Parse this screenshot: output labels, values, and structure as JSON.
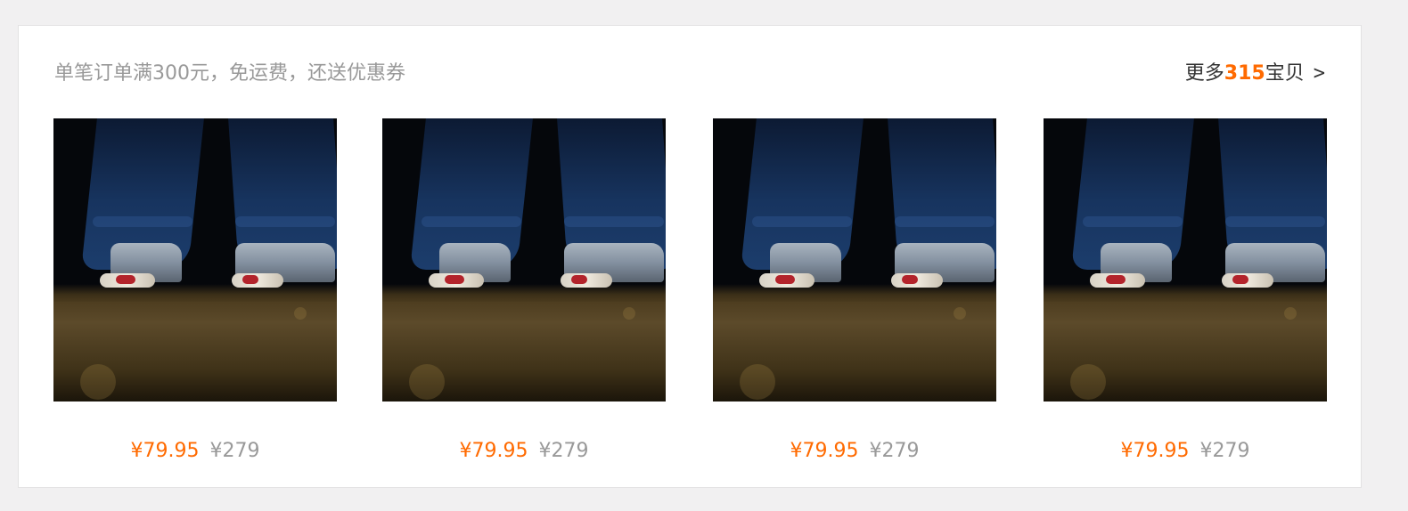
{
  "header": {
    "promo_text": "单笔订单满300元，免运费，还送优惠券",
    "more_prefix": "更多",
    "more_count": "315",
    "more_suffix": "宝贝",
    "more_arrow": ">"
  },
  "colors": {
    "accent": "#ff6a00",
    "muted_text": "#999999",
    "dark_text": "#333333",
    "page_bg": "#f1f0f1",
    "card_bg": "#ffffff"
  },
  "products": [
    {
      "price": "¥79.95",
      "original_price": "¥279",
      "image": "jeans-sneakers-photo"
    },
    {
      "price": "¥79.95",
      "original_price": "¥279",
      "image": "jeans-sneakers-photo"
    },
    {
      "price": "¥79.95",
      "original_price": "¥279",
      "image": "jeans-sneakers-photo"
    },
    {
      "price": "¥79.95",
      "original_price": "¥279",
      "image": "jeans-sneakers-photo"
    }
  ]
}
